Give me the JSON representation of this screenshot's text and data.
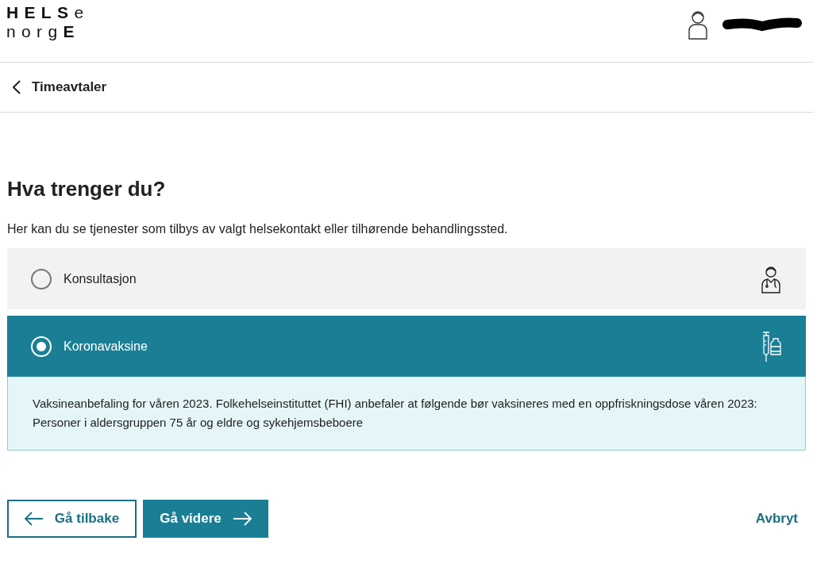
{
  "header": {
    "logo_lines": [
      "**HELS**e",
      "norg**E**"
    ]
  },
  "nav": {
    "back_label": "Timeavtaler"
  },
  "heading": "Hva trenger du?",
  "intro": "Her kan du se tjenester som tilbys av valgt helsekontakt eller tilhørende behandlingssted.",
  "options": [
    {
      "label": "Konsultasjon",
      "selected": false,
      "kind": "consultation"
    },
    {
      "label": "Koronavaksine",
      "selected": true,
      "kind": "vaccine",
      "description": "Vaksineanbefaling for våren 2023. Folkehelseinstituttet (FHI) anbefaler at følgende bør vaksineres med en oppfriskningsdose våren 2023: Personer i aldersgruppen 75 år og eldre og sykehjemsbeboere"
    }
  ],
  "buttons": {
    "back": "Gå tilbake",
    "next": "Gå videre",
    "cancel": "Avbryt"
  }
}
